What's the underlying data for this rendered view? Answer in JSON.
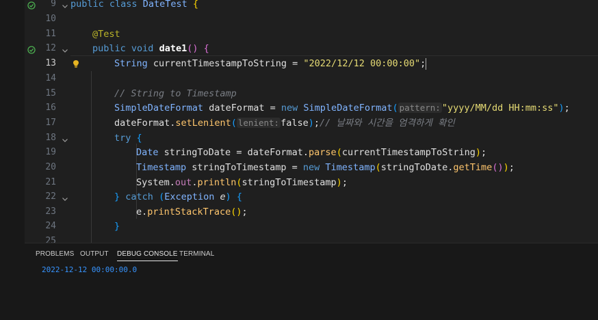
{
  "editor": {
    "lines": [
      {
        "num": "9",
        "code": "public class DateTest {"
      },
      {
        "num": "10",
        "code": ""
      },
      {
        "num": "11",
        "code": "    @Test"
      },
      {
        "num": "12",
        "code": "    public void date1() {"
      },
      {
        "num": "13",
        "code": "        String currentTimestampToString = \"2022/12/12 00:00:00\";"
      },
      {
        "num": "14",
        "code": ""
      },
      {
        "num": "15",
        "code": "        // String to Timestamp"
      },
      {
        "num": "16",
        "code": "        SimpleDateFormat dateFormat = new SimpleDateFormat(pattern: \"yyyy/MM/dd HH:mm:ss\");"
      },
      {
        "num": "17",
        "code": "        dateFormat.setLenient(lenient: false);// 날짜와 시간을 엄격하게 확인"
      },
      {
        "num": "18",
        "code": "        try {"
      },
      {
        "num": "19",
        "code": "            Date stringToDate = dateFormat.parse(currentTimestampToString);"
      },
      {
        "num": "20",
        "code": "            Timestamp stringToTimestamp = new Timestamp(stringToDate.getTime());"
      },
      {
        "num": "21",
        "code": "            System.out.println(stringToTimestamp);"
      },
      {
        "num": "22",
        "code": "        } catch (Exception e) {"
      },
      {
        "num": "23",
        "code": "            e.printStackTrace();"
      },
      {
        "num": "24",
        "code": "        }"
      },
      {
        "num": "25",
        "code": ""
      }
    ],
    "current_line": "13",
    "tokens": {
      "l9": [
        "public",
        "class",
        "DateTest",
        "{"
      ],
      "l11": "@Test",
      "l12": [
        "public",
        "void",
        "date1",
        "(",
        ")",
        "{"
      ],
      "l13": [
        "String",
        "currentTimestampToString",
        "=",
        "\"2022/12/12 00:00:00\"",
        ";"
      ],
      "l15": "// String to Timestamp",
      "l16": [
        "SimpleDateFormat",
        "dateFormat",
        "=",
        "new",
        "SimpleDateFormat",
        "(",
        "pattern:",
        "\"yyyy/MM/dd HH:mm:ss\"",
        ")",
        ";"
      ],
      "l17": [
        "dateFormat",
        ".",
        "setLenient",
        "(",
        "lenient:",
        "false",
        ")",
        ";",
        "// 날짜와 시간을 엄격하게 확인"
      ],
      "l18": [
        "try",
        "{"
      ],
      "l19": [
        "Date",
        "stringToDate",
        "=",
        "dateFormat",
        ".",
        "parse",
        "(",
        "currentTimestampToString",
        ")",
        ";"
      ],
      "l20": [
        "Timestamp",
        "stringToTimestamp",
        "=",
        "new",
        "Timestamp",
        "(",
        "stringToDate",
        ".",
        "getTime",
        "()",
        ")",
        ";"
      ],
      "l21": [
        "System",
        ".",
        "out",
        ".",
        "println",
        "(",
        "stringToTimestamp",
        ")",
        ";"
      ],
      "l22": [
        "}",
        "catch",
        "(",
        "Exception",
        "e",
        ")",
        "{"
      ],
      "l23": [
        "e",
        ".",
        "printStackTrace",
        "()",
        ";"
      ],
      "l24": "}"
    }
  },
  "panel": {
    "tabs": [
      "PROBLEMS",
      "OUTPUT",
      "DEBUG CONSOLE",
      "TERMINAL"
    ],
    "active_tab": "DEBUG CONSOLE",
    "output": "2022-12-12 00:00:00.0"
  },
  "colors": {
    "keyword": "#569cd6",
    "type": "#80b4ff",
    "method": "#ffc66d",
    "string": "#e6db74",
    "comment": "#7a7e85",
    "annotation": "#bbb529",
    "console_output": "#3794ff",
    "test_pass": "#4caf50",
    "hint_bulb": "#e6b422"
  },
  "icons": {
    "test_run": "check-circle-icon",
    "fold": "chevron-down-icon",
    "intention": "lightbulb-icon"
  }
}
